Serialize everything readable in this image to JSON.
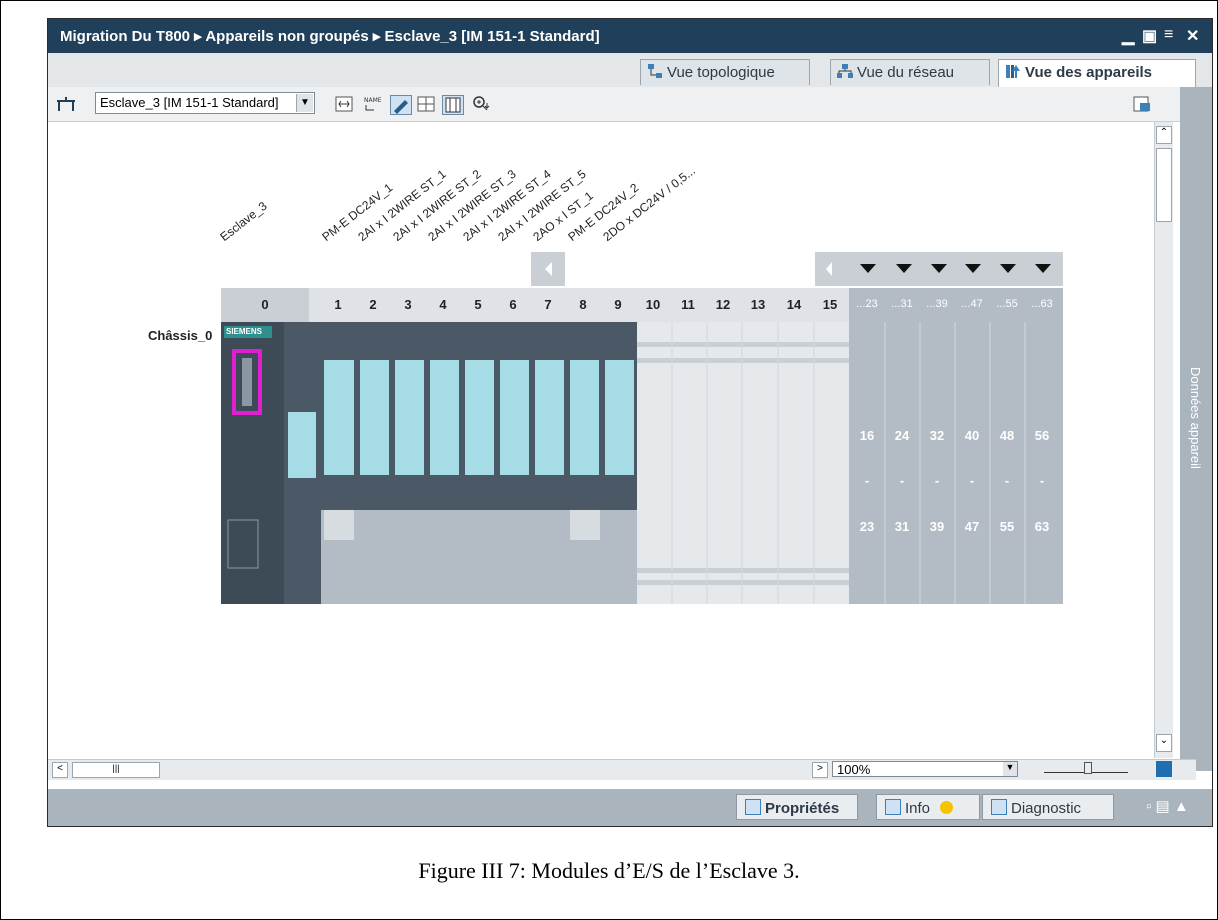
{
  "title_bar": {
    "breadcrumb": "Migration Du T800 ▸ Appareils non groupés ▸ Esclave_3 [IM 151-1 Standard]"
  },
  "view_tabs": [
    {
      "label": "Vue topologique",
      "icon": "topology-icon",
      "active": false
    },
    {
      "label": "Vue du réseau",
      "icon": "network-icon",
      "active": false
    },
    {
      "label": "Vue des appareils",
      "icon": "device-icon",
      "active": true
    }
  ],
  "toolbar": {
    "device_select_value": "Esclave_3 [IM 151-1 Standard]",
    "icons": [
      "connect-icon",
      "toggle-names-icon",
      "show-labels-icon",
      "grid-icon",
      "table-icon",
      "zoom-icon"
    ]
  },
  "rack": {
    "name": "Châssis_0",
    "slot_numbers": [
      "0",
      "1",
      "2",
      "3",
      "4",
      "5",
      "6",
      "7",
      "8",
      "9",
      "10",
      "11",
      "12",
      "13",
      "14",
      "15"
    ],
    "group_numbers": [
      "...23",
      "...31",
      "...39",
      "...47",
      "...55",
      "...63"
    ],
    "group_ranges": [
      {
        "from": "16",
        "sep": "-",
        "to": "23"
      },
      {
        "from": "24",
        "sep": "-",
        "to": "31"
      },
      {
        "from": "32",
        "sep": "-",
        "to": "39"
      },
      {
        "from": "40",
        "sep": "-",
        "to": "47"
      },
      {
        "from": "48",
        "sep": "-",
        "to": "55"
      },
      {
        "from": "56",
        "sep": "-",
        "to": "63"
      }
    ],
    "module_labels": [
      "Esclave_3",
      "PM-E DC24V_1",
      "2AI x I 2WIRE ST_1",
      "2AI x I 2WIRE ST_2",
      "2AI x I 2WIRE ST_3",
      "2AI x I 2WIRE ST_4",
      "2AI x I 2WIRE ST_5",
      "2AO x I ST_1",
      "PM-E DC24V_2",
      "2DO x DC24V / 0,5..."
    ],
    "head_brand": "SIEMENS"
  },
  "side_panel": {
    "label": "Données appareil"
  },
  "zoom": {
    "value": "100%"
  },
  "status_buttons": [
    {
      "label": "Propriétés",
      "icon": "properties-icon"
    },
    {
      "label": "Info",
      "icon": "info-icon"
    },
    {
      "label": "Diagnostic",
      "icon": "diagnostic-icon"
    }
  ],
  "caption": "Figure III 7: Modules d’E/S de l’Esclave 3.",
  "colors": {
    "titlebar": "#1f3f5a",
    "module": "#a6dce6",
    "head": "#3d4b57",
    "group": "#b3bbc4",
    "highlight": "#e020d0"
  }
}
